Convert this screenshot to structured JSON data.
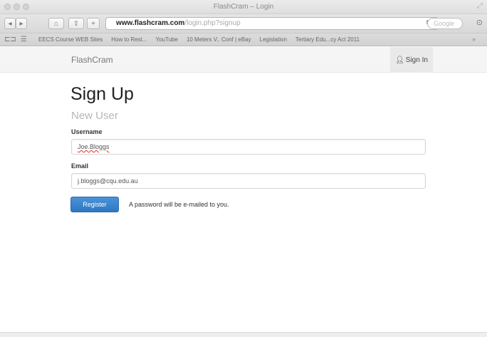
{
  "window": {
    "title": "FlashCram – Login"
  },
  "toolbar": {
    "url_host": "www.flashcram.com",
    "url_path": "/login.php?signup",
    "search_placeholder": "Google"
  },
  "bookmarks": [
    "EECS Course WEB Sites",
    "How to Rest...",
    "YouTube",
    "10 Meters V.. Conf | eBay",
    "Legislation",
    "Tertiary Edu...cy Act 2011"
  ],
  "navbar": {
    "brand": "FlashCram",
    "signin_label": "Sign In"
  },
  "form": {
    "heading": "Sign Up",
    "subheading": "New User",
    "username_label": "Username",
    "username_value": "Joe.Bloggs",
    "email_label": "Email",
    "email_value": "j.bloggs@cqu.edu.au",
    "register_label": "Register",
    "hint": "A password will be e-mailed to you."
  }
}
